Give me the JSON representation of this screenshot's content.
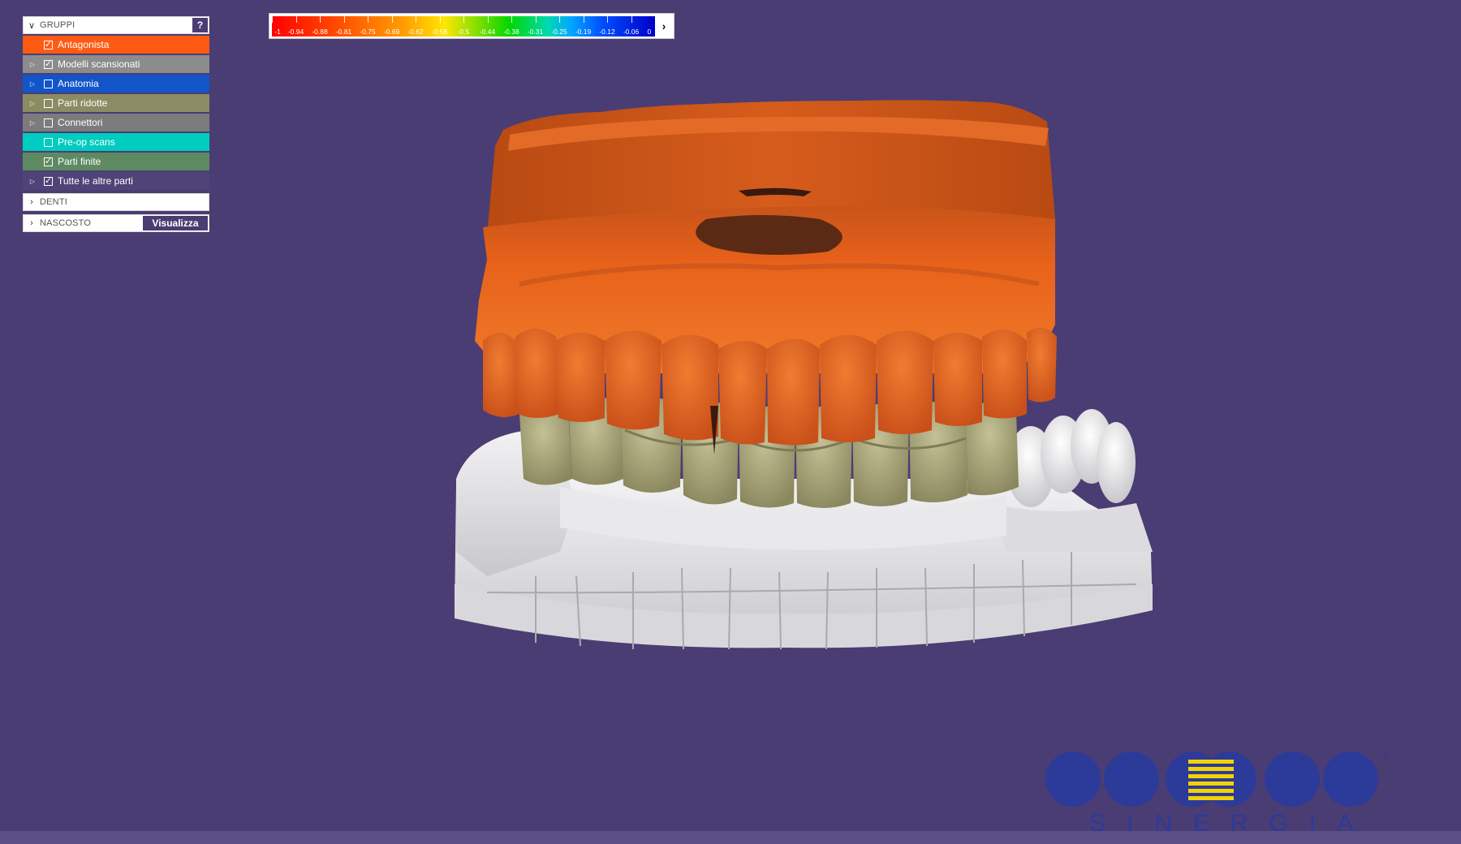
{
  "groups_panel": {
    "header": "GRUPPI",
    "help_label": "?",
    "items": [
      {
        "label": "Antagonista",
        "checked": true,
        "expandable": false,
        "color": "#ff5a14"
      },
      {
        "label": "Modelli scansionati",
        "checked": true,
        "expandable": true,
        "color": "#8c8c8c"
      },
      {
        "label": "Anatomia",
        "checked": false,
        "expandable": true,
        "color": "#1155c8"
      },
      {
        "label": "Parti ridotte",
        "checked": false,
        "expandable": true,
        "color": "#8c8c64"
      },
      {
        "label": "Connettori",
        "checked": false,
        "expandable": true,
        "color": "#7c7c7c"
      },
      {
        "label": "Pre-op scans",
        "checked": false,
        "expandable": false,
        "color": "#00ccc0"
      },
      {
        "label": "Parti finite",
        "checked": true,
        "expandable": false,
        "color": "#5e8a62"
      },
      {
        "label": "Tutte le altre parti",
        "checked": true,
        "expandable": true,
        "color": "#4e4478"
      }
    ]
  },
  "denti_section": {
    "label": "DENTI"
  },
  "hidden_section": {
    "label": "NASCOSTO",
    "button_label": "Visualizza"
  },
  "color_scale": {
    "labels": [
      "-1",
      "-0.94",
      "-0.88",
      "-0.81",
      "-0.75",
      "-0.69",
      "-0.62",
      "-0.56",
      "-0.5",
      "-0.44",
      "-0.38",
      "-0.31",
      "-0.25",
      "-0.19",
      "-0.12",
      "-0.06",
      "0"
    ],
    "next_icon": "chevron-right-icon"
  },
  "model_colors": {
    "antagonist": "#e8621a",
    "crowns": "#a9a57e",
    "scan_model": "#e4e4e6"
  },
  "logo": {
    "text": "SINERGIA",
    "mark": "®"
  }
}
